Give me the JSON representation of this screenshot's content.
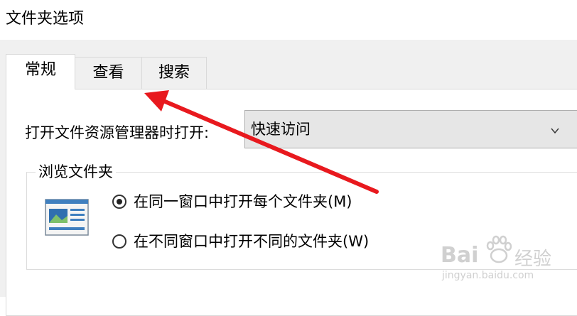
{
  "window": {
    "title": "文件夹选项"
  },
  "tabs": [
    {
      "label": "常规",
      "active": true
    },
    {
      "label": "查看",
      "active": false
    },
    {
      "label": "搜索",
      "active": false
    }
  ],
  "general": {
    "open_explorer_label": "打开文件资源管理器时打开:",
    "open_explorer_value": "快速访问",
    "browse_group": {
      "legend": "浏览文件夹",
      "options": [
        {
          "label": "在同一窗口中打开每个文件夹(M)",
          "selected": true
        },
        {
          "label": "在不同窗口中打开不同的文件夹(W)",
          "selected": false
        }
      ]
    }
  },
  "annotation": {
    "arrow_color": "#e8191e"
  },
  "watermark": {
    "brand_left": "Bai",
    "brand_right": "经验",
    "url": "jingyan.baidu.com"
  }
}
